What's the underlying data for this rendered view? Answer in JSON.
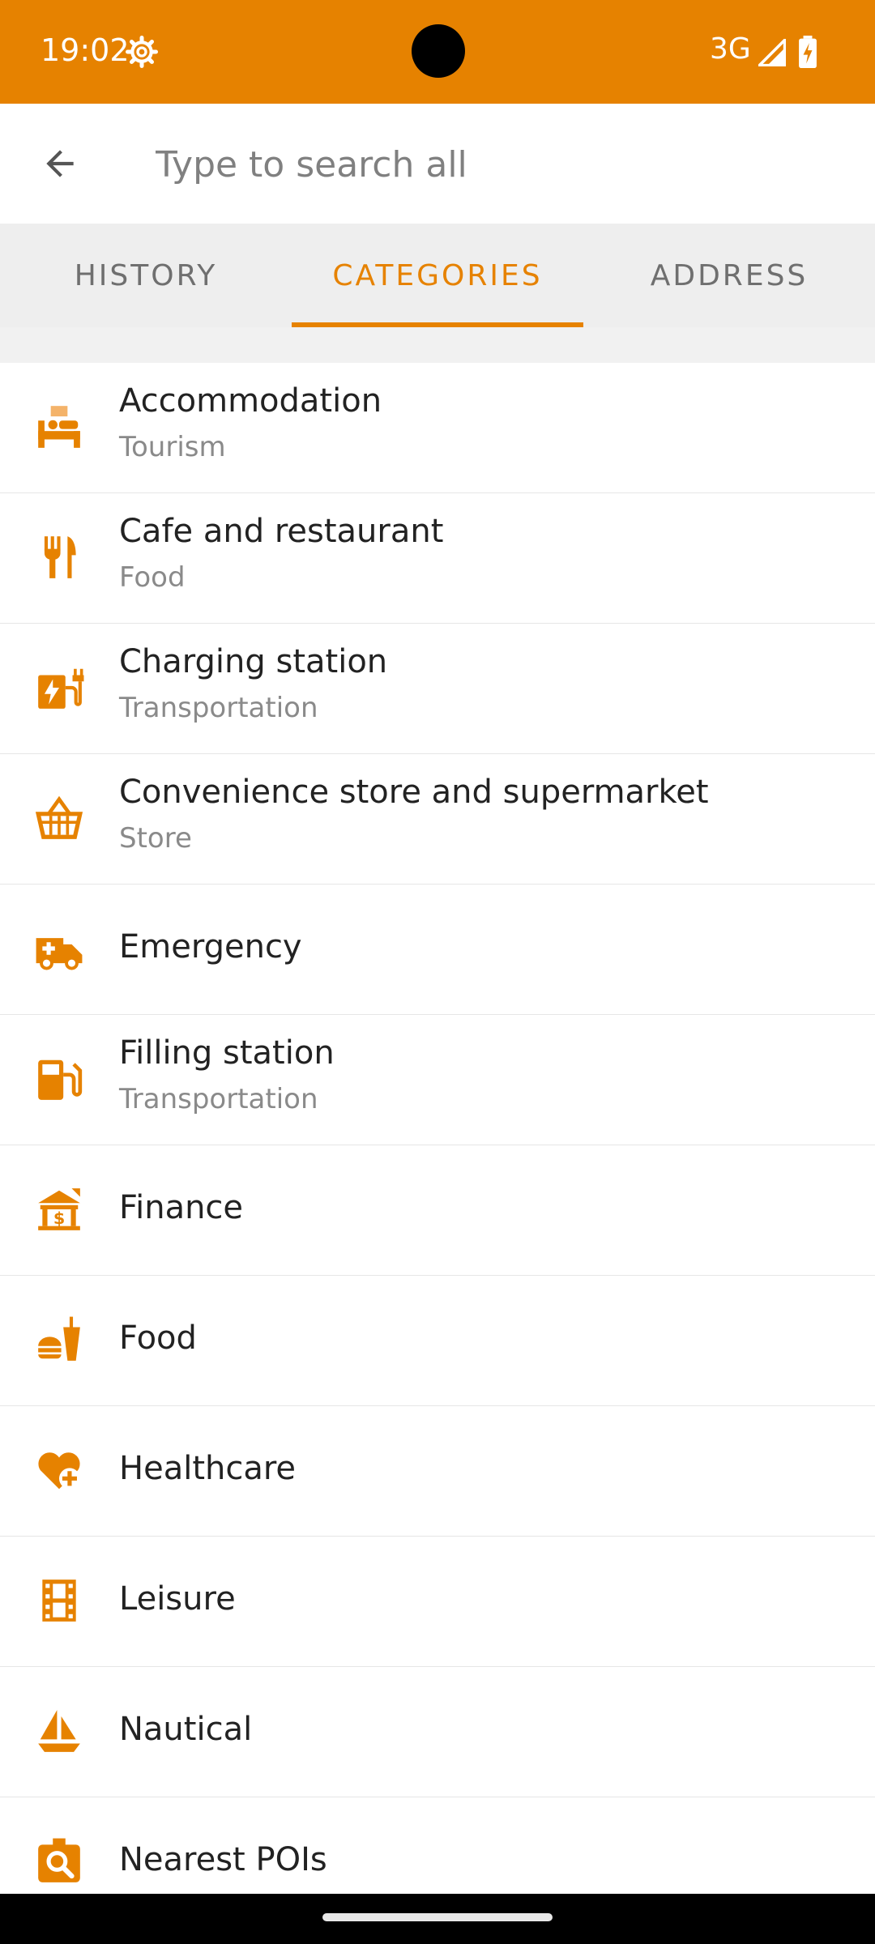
{
  "status_bar": {
    "time": "19:02",
    "network": "3G",
    "icons": [
      "gear-icon",
      "signal-icon",
      "battery-charging-icon"
    ]
  },
  "search": {
    "placeholder": "Type to search all",
    "value": ""
  },
  "tabs": [
    {
      "label": "HISTORY",
      "active": false
    },
    {
      "label": "CATEGORIES",
      "active": true
    },
    {
      "label": "ADDRESS",
      "active": false
    }
  ],
  "accent_color": "#e68200",
  "categories": [
    {
      "title": "Accommodation",
      "subtitle": "Tourism",
      "icon": "bed-icon"
    },
    {
      "title": "Cafe and restaurant",
      "subtitle": "Food",
      "icon": "fork-knife-icon"
    },
    {
      "title": "Charging station",
      "subtitle": "Transportation",
      "icon": "ev-charging-icon"
    },
    {
      "title": "Convenience store and supermarket",
      "subtitle": "Store",
      "icon": "basket-icon"
    },
    {
      "title": "Emergency",
      "subtitle": "",
      "icon": "ambulance-icon"
    },
    {
      "title": "Filling station",
      "subtitle": "Transportation",
      "icon": "fuel-pump-icon"
    },
    {
      "title": "Finance",
      "subtitle": "",
      "icon": "finance-icon"
    },
    {
      "title": "Food",
      "subtitle": "",
      "icon": "fastfood-icon"
    },
    {
      "title": "Healthcare",
      "subtitle": "",
      "icon": "healthcare-icon"
    },
    {
      "title": "Leisure",
      "subtitle": "",
      "icon": "film-icon"
    },
    {
      "title": "Nautical",
      "subtitle": "",
      "icon": "sailboat-icon"
    },
    {
      "title": "Nearest POIs",
      "subtitle": "",
      "icon": "search-map-icon"
    }
  ]
}
